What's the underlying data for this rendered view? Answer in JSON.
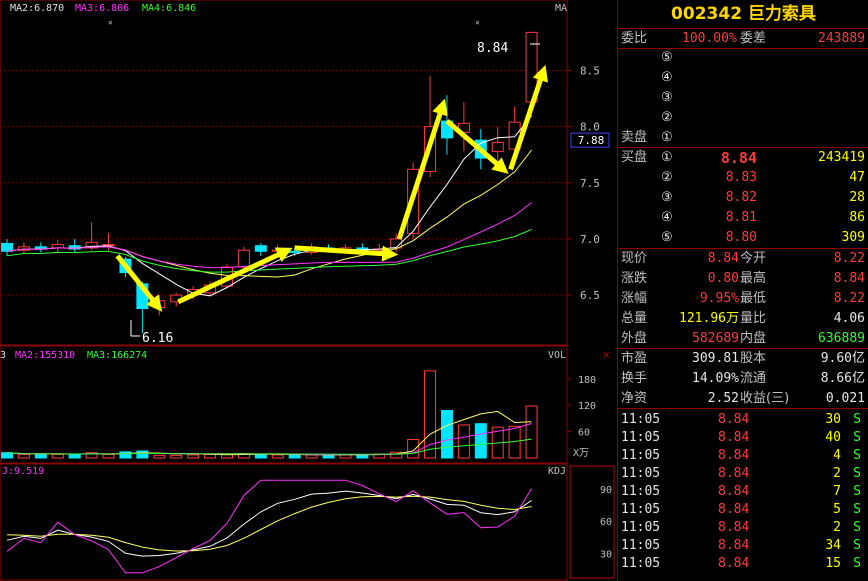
{
  "chart": {
    "ma_labels": [
      {
        "text": "MA2:6.870",
        "color": "#e0e0e0"
      },
      {
        "text": "MA3:6.806",
        "color": "#ff33ff"
      },
      {
        "text": "MA4:6.846",
        "color": "#33ff33"
      }
    ],
    "ma_tag": "MA",
    "price_axis": [
      "8.5",
      "8.0",
      "7.5",
      "7.0",
      "6.5"
    ],
    "current_price_tag": "7.88",
    "annot_high": "8.84",
    "annot_low": "6.16",
    "vol_labels": [
      {
        "text": "3",
        "color": "#e0e0e0"
      },
      {
        "text": "MA2:155310",
        "color": "#ff33ff"
      },
      {
        "text": "MA3:166274",
        "color": "#33ff33"
      }
    ],
    "vol_tag": "VOL",
    "vol_axis": [
      "180",
      "120",
      "60"
    ],
    "vol_unit": "X万",
    "kdj_label": "J:9.519",
    "kdj_tag": "KDJ",
    "kdj_axis": [
      "90",
      "60",
      "30"
    ],
    "close_glyph": "✕"
  },
  "quote": {
    "title": "002342 巨力索具",
    "webi_label": "委比",
    "webi_value": "100.00%",
    "weicha_label": "委差",
    "weicha_value": "243889",
    "sell_label": "卖盘",
    "buy_label": "买盘",
    "sell_levels": [
      "⑤",
      "④",
      "③",
      "②",
      "①"
    ],
    "buy_levels": [
      {
        "idx": "①",
        "price": "8.84",
        "vol": "243419"
      },
      {
        "idx": "②",
        "price": "8.83",
        "vol": "47"
      },
      {
        "idx": "③",
        "price": "8.82",
        "vol": "28"
      },
      {
        "idx": "④",
        "price": "8.81",
        "vol": "86"
      },
      {
        "idx": "⑤",
        "price": "8.80",
        "vol": "309"
      }
    ],
    "stats": [
      {
        "l1": "现价",
        "v1": "8.84",
        "l2": "今开",
        "v2": "8.22"
      },
      {
        "l1": "涨跌",
        "v1": "0.80",
        "l2": "最高",
        "v2": "8.84"
      },
      {
        "l1": "涨幅",
        "v1": "9.95%",
        "l2": "最低",
        "v2": "8.22"
      },
      {
        "l1": "总量",
        "v1": "121.96万",
        "l2": "量比",
        "v2": "4.06"
      },
      {
        "l1": "外盘",
        "v1": "582689",
        "l2": "内盘",
        "v2": "636889"
      }
    ],
    "fund": [
      {
        "l1": "市盈",
        "v1": "309.81",
        "l2": "股本",
        "v2": "9.60亿"
      },
      {
        "l1": "换手",
        "v1": "14.09%",
        "l2": "流通",
        "v2": "8.66亿"
      },
      {
        "l1": "净资",
        "v1": "2.52",
        "l2": "收益(三)",
        "v2": "0.021"
      }
    ],
    "ticks": [
      {
        "time": "11:05",
        "price": "8.84",
        "vol": "30",
        "bs": "S"
      },
      {
        "time": "11:05",
        "price": "8.84",
        "vol": "40",
        "bs": "S"
      },
      {
        "time": "11:05",
        "price": "8.84",
        "vol": "4",
        "bs": "S"
      },
      {
        "time": "11:05",
        "price": "8.84",
        "vol": "2",
        "bs": "S"
      },
      {
        "time": "11:05",
        "price": "8.84",
        "vol": "7",
        "bs": "S"
      },
      {
        "time": "11:05",
        "price": "8.84",
        "vol": "5",
        "bs": "S"
      },
      {
        "time": "11:05",
        "price": "8.84",
        "vol": "2",
        "bs": "S"
      },
      {
        "time": "11:05",
        "price": "8.84",
        "vol": "34",
        "bs": "S"
      },
      {
        "time": "11:05",
        "price": "8.84",
        "vol": "15",
        "bs": "S"
      }
    ]
  },
  "colors": {
    "up": "#ff3b3b",
    "down": "#00e5ff",
    "ma5": "#ffffff",
    "ma10": "#ffff66",
    "ma20": "#ff33ff",
    "ma60": "#33ff33",
    "grid": "#8b0000"
  },
  "chart_data": {
    "type": "candlestick",
    "candles": [
      {
        "o": 6.96,
        "c": 6.89,
        "h": 7.0,
        "l": 6.85,
        "v": 12
      },
      {
        "o": 6.9,
        "c": 6.93,
        "h": 6.97,
        "l": 6.87,
        "v": 8
      },
      {
        "o": 6.93,
        "c": 6.91,
        "h": 6.97,
        "l": 6.88,
        "v": 9
      },
      {
        "o": 6.92,
        "c": 6.95,
        "h": 6.99,
        "l": 6.88,
        "v": 8
      },
      {
        "o": 6.94,
        "c": 6.91,
        "h": 7.0,
        "l": 6.88,
        "v": 9
      },
      {
        "o": 6.92,
        "c": 6.97,
        "h": 7.15,
        "l": 6.9,
        "v": 12
      },
      {
        "o": 6.95,
        "c": 6.95,
        "h": 7.05,
        "l": 6.9,
        "v": 8
      },
      {
        "o": 6.82,
        "c": 6.7,
        "h": 6.84,
        "l": 6.66,
        "v": 14
      },
      {
        "o": 6.6,
        "c": 6.38,
        "h": 6.62,
        "l": 6.16,
        "v": 16
      },
      {
        "o": 6.39,
        "c": 6.45,
        "h": 6.5,
        "l": 6.32,
        "v": 6
      },
      {
        "o": 6.44,
        "c": 6.5,
        "h": 6.52,
        "l": 6.4,
        "v": 6
      },
      {
        "o": 6.5,
        "c": 6.55,
        "h": 6.58,
        "l": 6.46,
        "v": 7
      },
      {
        "o": 6.52,
        "c": 6.59,
        "h": 6.62,
        "l": 6.49,
        "v": 8
      },
      {
        "o": 6.58,
        "c": 6.75,
        "h": 6.78,
        "l": 6.56,
        "v": 9
      },
      {
        "o": 6.75,
        "c": 6.9,
        "h": 6.93,
        "l": 6.72,
        "v": 10
      },
      {
        "o": 6.94,
        "c": 6.89,
        "h": 6.96,
        "l": 6.85,
        "v": 8
      },
      {
        "o": 6.9,
        "c": 6.9,
        "h": 6.95,
        "l": 6.86,
        "v": 7
      },
      {
        "o": 6.89,
        "c": 6.88,
        "h": 6.92,
        "l": 6.85,
        "v": 6
      },
      {
        "o": 6.88,
        "c": 6.93,
        "h": 6.96,
        "l": 6.86,
        "v": 7
      },
      {
        "o": 6.92,
        "c": 6.9,
        "h": 6.95,
        "l": 6.88,
        "v": 7
      },
      {
        "o": 6.9,
        "c": 6.92,
        "h": 6.95,
        "l": 6.87,
        "v": 8
      },
      {
        "o": 6.92,
        "c": 6.89,
        "h": 6.96,
        "l": 6.87,
        "v": 8
      },
      {
        "o": 6.9,
        "c": 6.91,
        "h": 6.96,
        "l": 6.88,
        "v": 9
      },
      {
        "o": 6.92,
        "c": 7.0,
        "h": 7.05,
        "l": 6.88,
        "v": 13
      },
      {
        "o": 7.05,
        "c": 7.62,
        "h": 7.68,
        "l": 7.0,
        "v": 42
      },
      {
        "o": 7.6,
        "c": 8.0,
        "h": 8.45,
        "l": 7.55,
        "v": 198
      },
      {
        "o": 8.05,
        "c": 7.9,
        "h": 8.28,
        "l": 7.75,
        "v": 108
      },
      {
        "o": 7.95,
        "c": 8.03,
        "h": 8.22,
        "l": 7.78,
        "v": 75
      },
      {
        "o": 7.88,
        "c": 7.72,
        "h": 7.98,
        "l": 7.62,
        "v": 78
      },
      {
        "o": 7.78,
        "c": 7.86,
        "h": 8.0,
        "l": 7.7,
        "v": 70
      },
      {
        "o": 7.8,
        "c": 8.04,
        "h": 8.18,
        "l": 7.72,
        "v": 72
      },
      {
        "o": 8.22,
        "c": 8.84,
        "h": 8.84,
        "l": 8.22,
        "v": 118
      }
    ],
    "ylim": [
      6.1,
      8.95
    ],
    "vol_ylim": [
      0,
      200
    ],
    "kdj_ylim": [
      10,
      100
    ]
  }
}
